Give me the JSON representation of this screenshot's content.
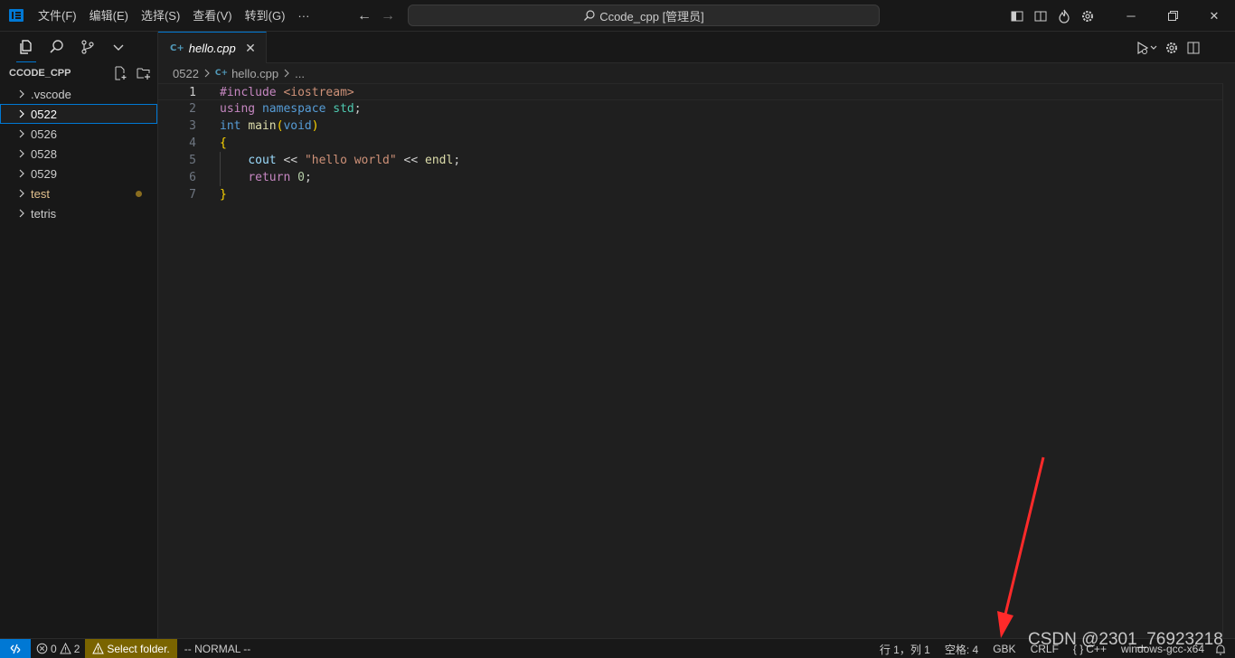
{
  "titlebar": {
    "menu": [
      "文件(F)",
      "编辑(E)",
      "选择(S)",
      "查看(V)",
      "转到(G)",
      "···"
    ],
    "command_center": "Ccode_cpp [管理员]"
  },
  "sidebar": {
    "title": "CCODE_CPP",
    "items": [
      {
        "label": ".vscode"
      },
      {
        "label": "0522"
      },
      {
        "label": "0526"
      },
      {
        "label": "0528"
      },
      {
        "label": "0529"
      },
      {
        "label": "test"
      },
      {
        "label": "tetris"
      }
    ]
  },
  "editor": {
    "tab_label": "hello.cpp",
    "tab_icon_glyph": "C+",
    "breadcrumb": {
      "folder": "0522",
      "file": "hello.cpp",
      "more": "..."
    },
    "line_numbers": [
      "1",
      "2",
      "3",
      "4",
      "5",
      "6",
      "7"
    ],
    "code": {
      "l1_directive": "#include",
      "l1_header": "<iostream>",
      "l2_using": "using",
      "l2_namespace": "namespace",
      "l2_std": "std",
      "l2_semi": ";",
      "l3_int": "int",
      "l3_main": "main",
      "l3_open": "(",
      "l3_void": "void",
      "l3_close": ")",
      "l4_brace": "{",
      "l5_cout": "cout",
      "l5_op1": " << ",
      "l5_str": "\"hello world\"",
      "l5_op2": " << ",
      "l5_endl": "endl",
      "l5_semi": ";",
      "l6_return": "return",
      "l6_zero": "0",
      "l6_semi": ";",
      "l7_brace": "}"
    }
  },
  "statusbar": {
    "errors": "0",
    "warnings": "2",
    "select_folder": "Select folder.",
    "vim_mode": "-- NORMAL --",
    "position": "行 1，列 1",
    "spaces": "空格: 4",
    "encoding": "GBK",
    "eol": "CRLF",
    "language": "C++",
    "language_icon": "{ }",
    "config": "windows-gcc-x64"
  },
  "watermark": "CSDN @2301_76923218",
  "colors": {
    "accent": "#0078d4",
    "annotation_arrow": "#ff2a2a",
    "warning_bg": "#7a6400"
  }
}
